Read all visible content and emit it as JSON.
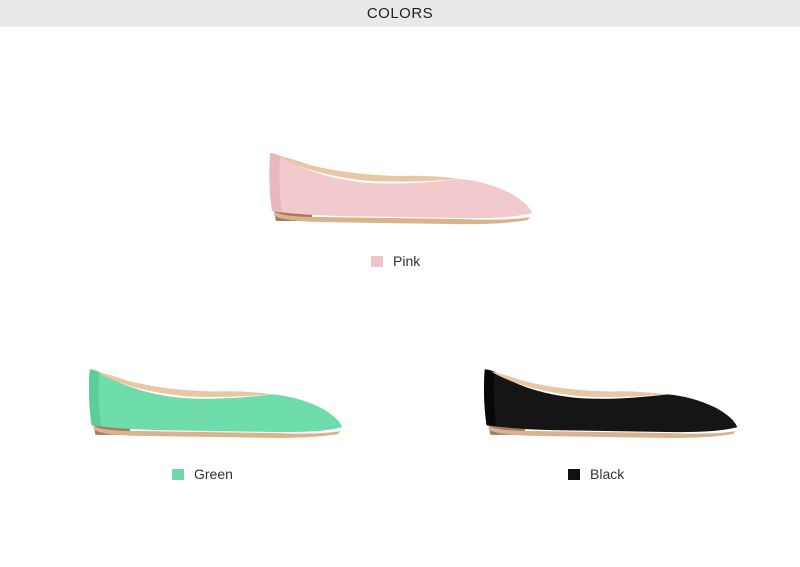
{
  "header": {
    "title": "COLORS"
  },
  "colors": [
    {
      "name": "Pink",
      "swatch": "#f0c4c7",
      "upper": "#f2c9cc",
      "upper_shade": "#e2aeb3"
    },
    {
      "name": "Green",
      "swatch": "#6ed8a8",
      "upper": "#6fdcab",
      "upper_shade": "#4fc58f"
    },
    {
      "name": "Black",
      "swatch": "#111111",
      "upper": "#151515",
      "upper_shade": "#000000"
    }
  ],
  "shoe_parts": {
    "lining": "#e9c6a4",
    "sole": "#d9b38d",
    "heel": "#a57a63"
  }
}
